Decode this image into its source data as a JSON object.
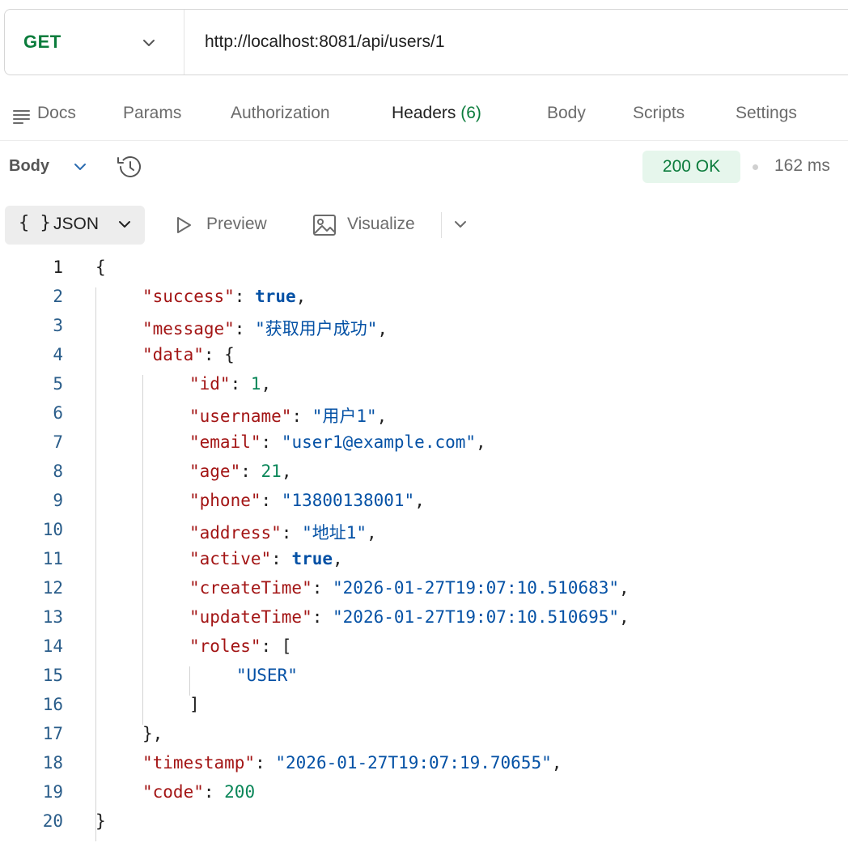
{
  "request": {
    "method": "GET",
    "url": "http://localhost:8081/api/users/1"
  },
  "tabs": [
    {
      "label": "Docs"
    },
    {
      "label": "Params"
    },
    {
      "label": "Authorization"
    },
    {
      "label": "Headers",
      "count": "(6)"
    },
    {
      "label": "Body"
    },
    {
      "label": "Scripts"
    },
    {
      "label": "Settings"
    }
  ],
  "response": {
    "section_label": "Body",
    "status": "200 OK",
    "time": "162 ms",
    "format": "JSON",
    "preview_label": "Preview",
    "visualize_label": "Visualize"
  },
  "colors": {
    "method": "#0b7c3c",
    "key": "#a31515",
    "string": "#0451a5",
    "number": "#098658",
    "status_bg": "#e6f6ec"
  },
  "code_lines": [
    {
      "n": "1",
      "t": "{"
    },
    {
      "n": "2",
      "t": "\"success\": true,"
    },
    {
      "n": "3",
      "t": "\"message\": \"获取用户成功\","
    },
    {
      "n": "4",
      "t": "\"data\": {"
    },
    {
      "n": "5",
      "t": "\"id\": 1,"
    },
    {
      "n": "6",
      "t": "\"username\": \"用户1\","
    },
    {
      "n": "7",
      "t": "\"email\": \"user1@example.com\","
    },
    {
      "n": "8",
      "t": "\"age\": 21,"
    },
    {
      "n": "9",
      "t": "\"phone\": \"13800138001\","
    },
    {
      "n": "10",
      "t": "\"address\": \"地址1\","
    },
    {
      "n": "11",
      "t": "\"active\": true,"
    },
    {
      "n": "12",
      "t": "\"createTime\": \"2026-01-27T19:07:10.510683\","
    },
    {
      "n": "13",
      "t": "\"updateTime\": \"2026-01-27T19:07:10.510695\","
    },
    {
      "n": "14",
      "t": "\"roles\": ["
    },
    {
      "n": "15",
      "t": "\"USER\""
    },
    {
      "n": "16",
      "t": "]"
    },
    {
      "n": "17",
      "t": "},"
    },
    {
      "n": "18",
      "t": "\"timestamp\": \"2026-01-27T19:07:19.70655\","
    },
    {
      "n": "19",
      "t": "\"code\": 200"
    },
    {
      "n": "20",
      "t": "}"
    }
  ]
}
